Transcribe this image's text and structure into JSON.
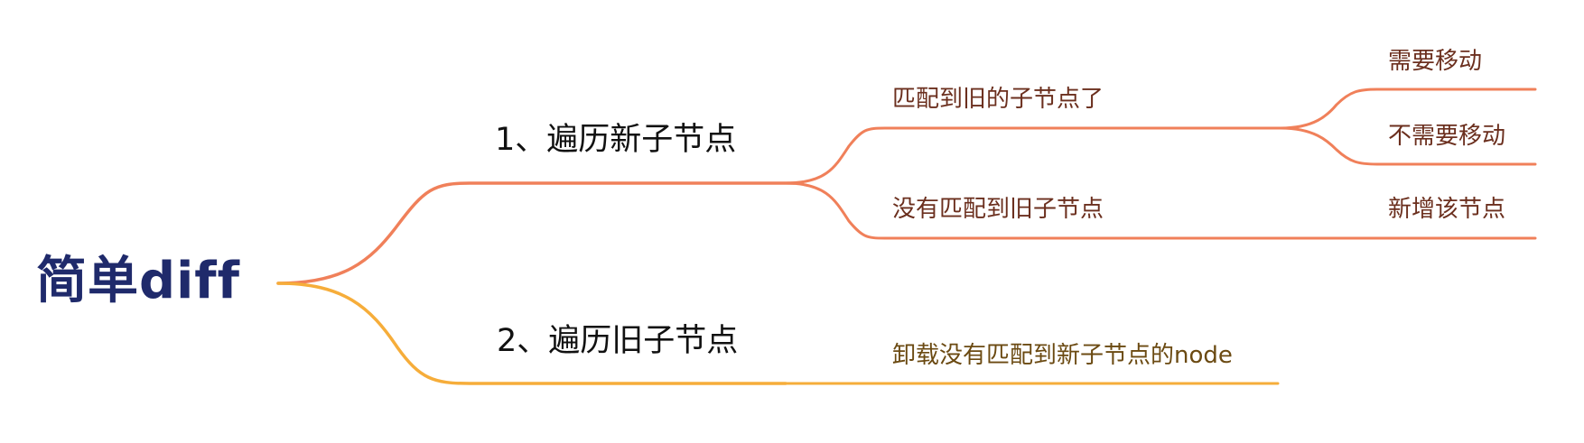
{
  "colors": {
    "root_text": "#1f2a6b",
    "branch_orange": "#f0805a",
    "branch_yellow": "#f6ad3a",
    "leaf_text_orange": "#6b2f1e",
    "leaf_text_yellow": "#6b4a12"
  },
  "mindmap": {
    "root": "简单diff",
    "branches": [
      {
        "label": "1、遍历新子节点",
        "children": [
          {
            "label": "匹配到旧的子节点了",
            "children": [
              "需要移动",
              "不需要移动"
            ]
          },
          {
            "label": "没有匹配到旧子节点",
            "children": [
              "新增该节点"
            ]
          }
        ]
      },
      {
        "label": "2、遍历旧子节点",
        "children": [
          {
            "label": "卸载没有匹配到新子节点的node",
            "children": []
          }
        ]
      }
    ]
  }
}
